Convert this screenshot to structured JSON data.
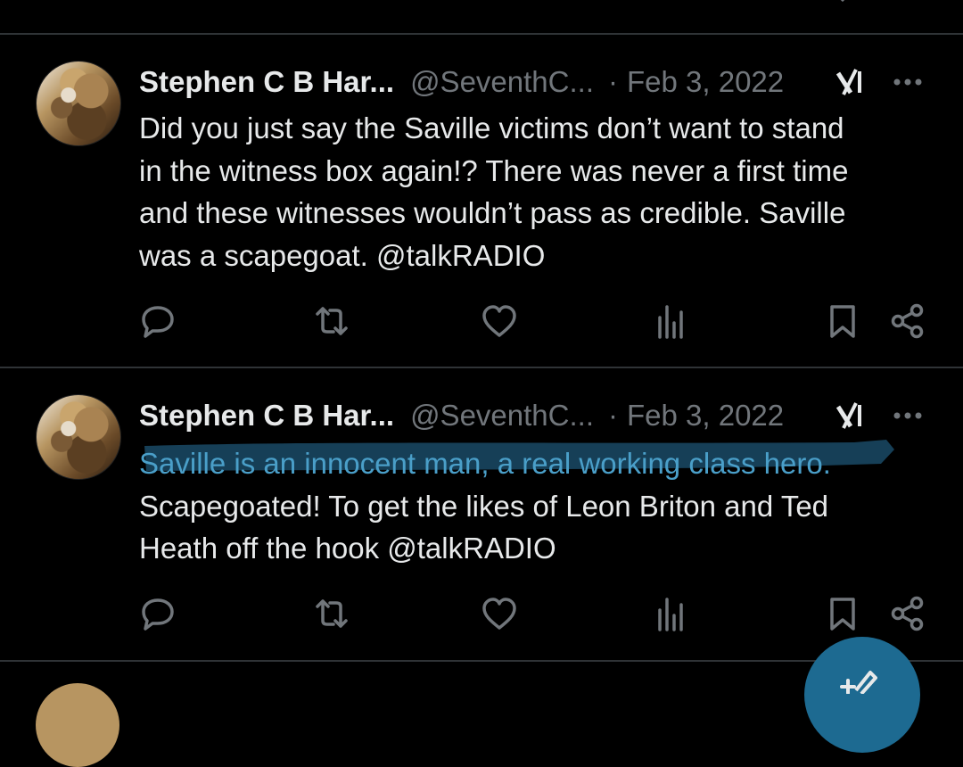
{
  "colors": {
    "background": "#000000",
    "text": "#e7e9ea",
    "muted": "#71767b",
    "divider": "#2f3336",
    "highlight_stroke": "#1a4a66",
    "highlighted_text": "#4a9fc9",
    "fab": "#1d6a91"
  },
  "tweets": [
    {
      "name": "Stephen C B Har...",
      "handle": "@SeventhC...",
      "separator": "·",
      "date": "Feb 3, 2022",
      "text_lines": [
        "Did you just say the Saville victims don’t want to stand",
        "in the witness box again!? There was never a first time",
        "and these witnesses wouldn’t pass as credible. Saville",
        "was a scapegoat. @talkRADIO"
      ],
      "icons": [
        "avatar",
        "grok-icon",
        "more-icon",
        "reply-icon",
        "retweet-icon",
        "like-icon",
        "views-icon",
        "bookmark-icon",
        "share-icon"
      ]
    },
    {
      "name": "Stephen C B Har...",
      "handle": "@SeventhC...",
      "separator": "·",
      "date": "Feb 3, 2022",
      "highlighted_line": "Saville is an innocent man, a real working class hero.",
      "text_lines": [
        "Scapegoated! To get the likes of Leon Briton and Ted",
        "Heath off the hook @talkRADIO"
      ],
      "icons": [
        "avatar",
        "grok-icon",
        "more-icon",
        "reply-icon",
        "retweet-icon",
        "like-icon",
        "views-icon",
        "bookmark-icon",
        "share-icon"
      ]
    }
  ],
  "fab": {
    "icon": "compose-icon"
  }
}
